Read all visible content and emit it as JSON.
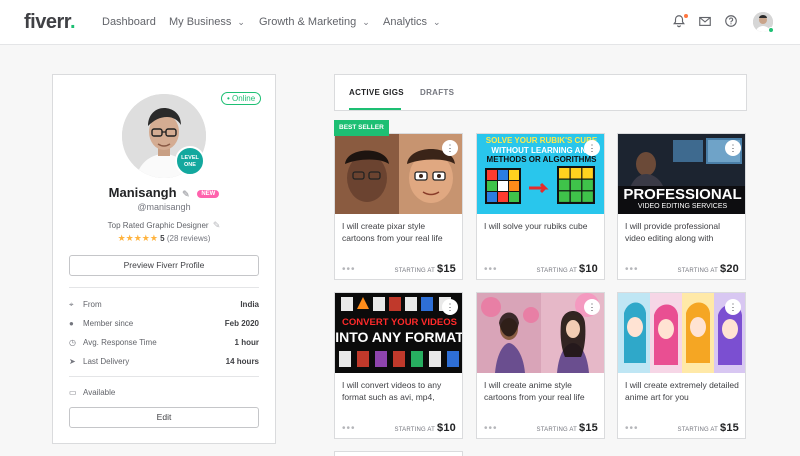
{
  "nav": {
    "logo": "fiverr",
    "logo_dot": ".",
    "items": [
      {
        "label": "Dashboard",
        "chevron": false
      },
      {
        "label": "My Business",
        "chevron": true
      },
      {
        "label": "Growth & Marketing",
        "chevron": true
      },
      {
        "label": "Analytics",
        "chevron": true
      }
    ],
    "icons": [
      "bell-icon",
      "mail-icon",
      "help-icon",
      "avatar"
    ]
  },
  "profile": {
    "online": "• Online",
    "level_line1": "LEVEL",
    "level_line2": "ONE",
    "name": "Manisangh",
    "new_badge": "NEW",
    "handle": "@manisangh",
    "title": "Top Rated Graphic Designer",
    "stars": "★★★★★",
    "rating": "5",
    "reviews": "(28 reviews)",
    "preview_button": "Preview Fiverr Profile",
    "stats": [
      {
        "icon": "location-icon",
        "label": "From",
        "value": "India"
      },
      {
        "icon": "user-icon",
        "label": "Member since",
        "value": "Feb 2020"
      },
      {
        "icon": "clock-icon",
        "label": "Avg. Response Time",
        "value": "1 hour"
      },
      {
        "icon": "send-icon",
        "label": "Last Delivery",
        "value": "14 hours"
      }
    ],
    "availability_label": "Available",
    "edit_button": "Edit"
  },
  "tabs": [
    {
      "label": "ACTIVE GIGS",
      "active": true
    },
    {
      "label": "DRAFTS",
      "active": false
    }
  ],
  "best_seller": "BEST SELLER",
  "gigs": [
    {
      "title": "I will create pixar style cartoons from your real life",
      "price_label": "STARTING AT",
      "price": "$15",
      "thumb": "pixar"
    },
    {
      "title": "I will solve your rubiks cube",
      "price_label": "STARTING AT",
      "price": "$10",
      "thumb": "rubik",
      "thumb_text": [
        "SOLVE YOUR RUBIK'S CUBE",
        "WITHOUT LEARNING ANY",
        "METHODS OR ALGORITHMS"
      ]
    },
    {
      "title": "I will provide professional video editing along with",
      "price_label": "STARTING AT",
      "price": "$20",
      "thumb": "editing",
      "thumb_text": [
        "PROFESSIONAL",
        "VIDEO EDITING SERVICES"
      ]
    },
    {
      "title": "I will convert videos to any format such as avi, mp4,",
      "price_label": "STARTING AT",
      "price": "$10",
      "thumb": "convert",
      "thumb_text": [
        "CONVERT YOUR VIDEOS",
        "INTO ANY FORMAT"
      ]
    },
    {
      "title": "I will create anime style cartoons from your real life",
      "price_label": "STARTING AT",
      "price": "$15",
      "thumb": "anime"
    },
    {
      "title": "I will create extremely detailed anime art for you",
      "price_label": "STARTING AT",
      "price": "$15",
      "thumb": "animeart"
    }
  ],
  "colors": {
    "brand": "#1dbf73",
    "new_badge": "#ff62ad",
    "star": "#ffb33e",
    "level": "#13a89e"
  }
}
